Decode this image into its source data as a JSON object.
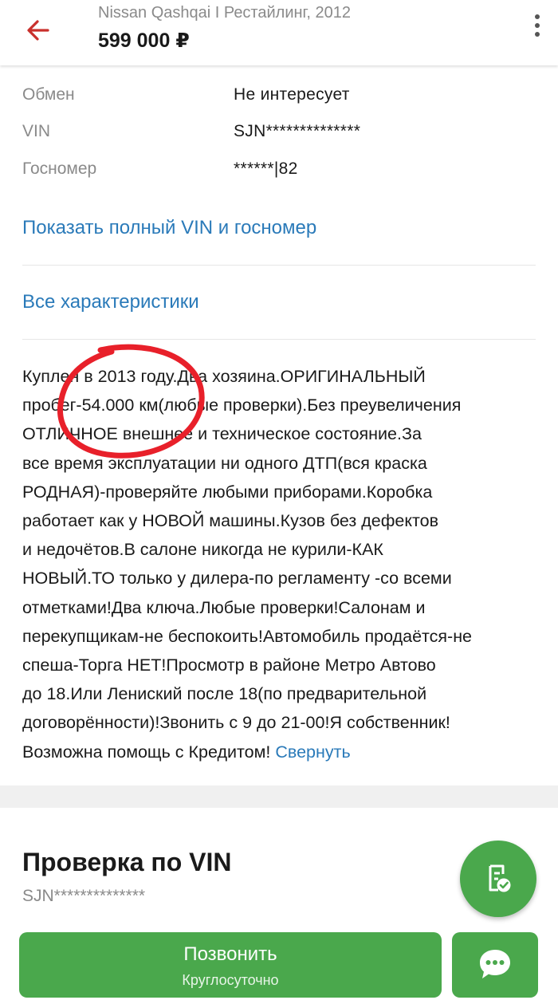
{
  "header": {
    "subtitle": "Nissan Qashqai I Рестайлинг, 2012",
    "price": "599 000 ₽",
    "back_icon": "arrow-left-icon",
    "menu_icon": "more-vertical-icon",
    "back_color": "#c9302c"
  },
  "specs": [
    {
      "label": "Обмен",
      "value": "Не интересует"
    },
    {
      "label": "VIN",
      "value": "SJN**************"
    },
    {
      "label": "Госномер",
      "value": "******|82"
    }
  ],
  "links": {
    "show_vin": "Показать полный VIN и госномер",
    "all_specs": "Все характеристики"
  },
  "description": {
    "lines": [
      "Куплен в 2013 году.Два хозяина.ОРИГИНАЛЬНЫЙ",
      "пробег-54.000 км(любые проверки).Без преувеличения",
      "ОТЛИЧНОЕ внешнее и техническое состояние.За",
      "все время эксплуатации ни одного ДТП(вся краска",
      "РОДНАЯ)-проверяйте любыми приборами.Коробка",
      "работает как у НОВОЙ машины.Кузов без дефектов",
      "и недочётов.В салоне никогда не курили-КАК",
      "НОВЫЙ.ТО только у дилера-по регламенту -со всеми",
      "отметками!Два ключа.Любые проверки!Салонам и",
      "перекупщикам-не беспокоить!Автомобиль продаётся-не",
      "спеша-Торга НЕТ!Просмотр в районе Метро Автово",
      "до 18.Или Лениский после 18(по предварительной",
      "договорённости)!Звонить с 9 до 21-00!Я собственник!",
      "Возможна помощь с Кредитом!"
    ],
    "collapse_label": "Свернуть"
  },
  "vin_check": {
    "title": "Проверка по VIN",
    "vin": "SJN**************",
    "fab_icon": "report-check-icon"
  },
  "bottom": {
    "call_label": "Позвонить",
    "call_sub": "Круглосуточно",
    "chat_icon": "chat-bubble-icon",
    "accent": "#4aa84c"
  },
  "colors": {
    "link": "#2a7ab9",
    "annotation": "#e8202a"
  }
}
